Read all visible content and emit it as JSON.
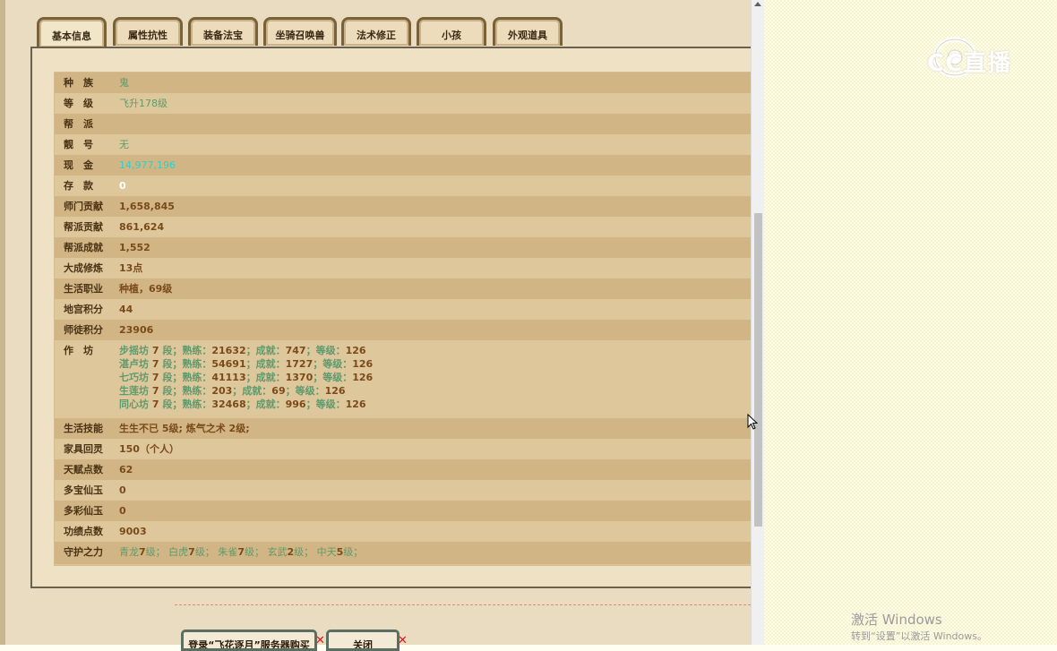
{
  "tabs": [
    {
      "label": "基本信息",
      "active": true
    },
    {
      "label": "属性抗性",
      "active": false
    },
    {
      "label": "装备法宝",
      "active": false
    },
    {
      "label": "坐骑召唤兽",
      "active": false
    },
    {
      "label": "法术修正",
      "active": false
    },
    {
      "label": "小孩",
      "active": false
    },
    {
      "label": "外观道具",
      "active": false
    }
  ],
  "rows": [
    {
      "label": "种　族",
      "value": "鬼",
      "style": "green"
    },
    {
      "label": "等　级",
      "value": "飞升178级",
      "style": "green"
    },
    {
      "label": "帮　派",
      "value": "",
      "style": "green"
    },
    {
      "label": "靓　号",
      "value": "无",
      "style": "green"
    },
    {
      "label": "现　金",
      "value": "14,977,196",
      "style": "cyan"
    },
    {
      "label": "存　款",
      "value": "0",
      "style": "white"
    },
    {
      "label": "师门贡献",
      "value": "1,658,845",
      "style": "brown"
    },
    {
      "label": "帮派贡献",
      "value": "861,624",
      "style": "brown"
    },
    {
      "label": "帮派成就",
      "value": "1,552",
      "style": "brown"
    },
    {
      "label": "大成修炼",
      "value": "13点",
      "style": "brown"
    },
    {
      "label": "生活职业",
      "value": "种植，69级",
      "style": "brown"
    },
    {
      "label": "地宫积分",
      "value": "44",
      "style": "brown"
    },
    {
      "label": "师徒积分",
      "value": "23906",
      "style": "brown"
    }
  ],
  "workshop": {
    "label": "作　坊",
    "lines": [
      {
        "name": "步摇坊",
        "seg": "7",
        "skill": "21632",
        "achieve": "747",
        "level": "126"
      },
      {
        "name": "湛卢坊",
        "seg": "7",
        "skill": "54691",
        "achieve": "1727",
        "level": "126"
      },
      {
        "name": "七巧坊",
        "seg": "7",
        "skill": "41113",
        "achieve": "1370",
        "level": "126"
      },
      {
        "name": "生莲坊",
        "seg": "7",
        "skill": "203",
        "achieve": "69",
        "level": "126"
      },
      {
        "name": "同心坊",
        "seg": "7",
        "skill": "32468",
        "achieve": "996",
        "level": "126"
      }
    ],
    "seg_unit": "段；熟练：",
    "achieve_label": "；成就：",
    "level_label": "；等级："
  },
  "rows2": [
    {
      "label": "生活技能",
      "value": "生生不已 5级; 炼气之术 2级;",
      "style": "brown"
    },
    {
      "label": "家具回灵",
      "value": "150（个人）",
      "style": "brown"
    },
    {
      "label": "天赋点数",
      "value": "62",
      "style": "brown"
    },
    {
      "label": "多宝仙玉",
      "value": "0",
      "style": "brown"
    },
    {
      "label": "多彩仙玉",
      "value": "0",
      "style": "brown"
    },
    {
      "label": "功绩点数",
      "value": "9003",
      "style": "brown"
    }
  ],
  "guardian": {
    "label": "守护之力",
    "items": [
      {
        "name": "青龙",
        "lv": "7",
        "unit": "级；"
      },
      {
        "name": "白虎",
        "lv": "7",
        "unit": "级；"
      },
      {
        "name": "朱雀",
        "lv": "7",
        "unit": "级；"
      },
      {
        "name": "玄武",
        "lv": "2",
        "unit": "级；"
      },
      {
        "name": "中天",
        "lv": "5",
        "unit": "级；"
      }
    ]
  },
  "buttons": {
    "login": "登录“飞花逐月”服务器购买",
    "close": "关闭"
  },
  "watermark": {
    "brand": "CC直播",
    "activate_title": "激活 Windows",
    "activate_sub": "转到“设置”以激活 Windows。"
  },
  "colors": {
    "label": "#4a3314",
    "value_brown": "#7a4a1a",
    "value_green": "#5e9a6e",
    "value_cyan": "#2ed0c8"
  }
}
